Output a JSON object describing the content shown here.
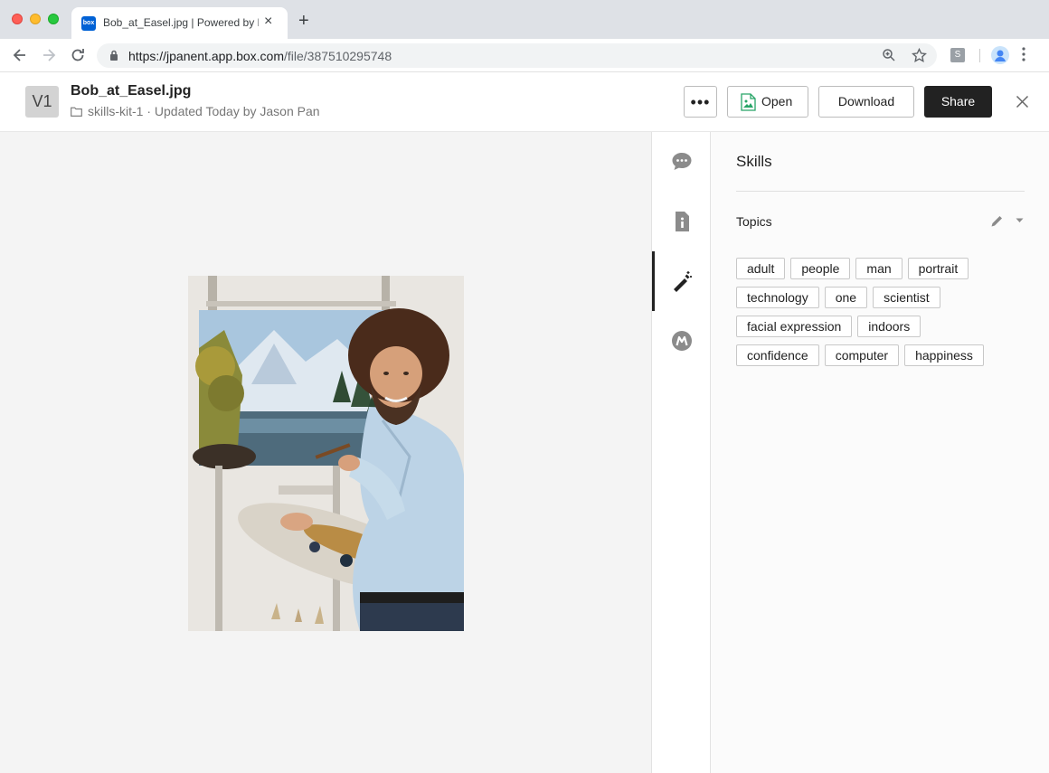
{
  "browser": {
    "tab_title": "Bob_at_Easel.jpg | Powered by Box",
    "favicon_text": "box",
    "url_host": "https://jpanent.app.box.com",
    "url_path": "/file/387510295748",
    "extension_label": "S"
  },
  "header": {
    "version_badge": "V1",
    "file_name": "Bob_at_Easel.jpg",
    "folder": "skills-kit-1",
    "updated": "· Updated Today by Jason Pan",
    "more_label": "•••",
    "open_label": "Open",
    "download_label": "Download",
    "share_label": "Share"
  },
  "skills_panel": {
    "title": "Skills",
    "section_label": "Topics",
    "topics": [
      [
        "adult",
        "people",
        "man",
        "portrait"
      ],
      [
        "technology",
        "one",
        "scientist"
      ],
      [
        "facial expression",
        "indoors"
      ],
      [
        "confidence",
        "computer",
        "happiness"
      ]
    ]
  },
  "sidebar_nav": [
    {
      "icon": "comment-icon",
      "active": false
    },
    {
      "icon": "info-icon",
      "active": false
    },
    {
      "icon": "magic-wand-icon",
      "active": true
    },
    {
      "icon": "metadata-icon",
      "active": false
    }
  ],
  "colors": {
    "share_button_bg": "#222222",
    "preview_bg": "#f4f4f4",
    "brand_blue": "#0061d5"
  }
}
